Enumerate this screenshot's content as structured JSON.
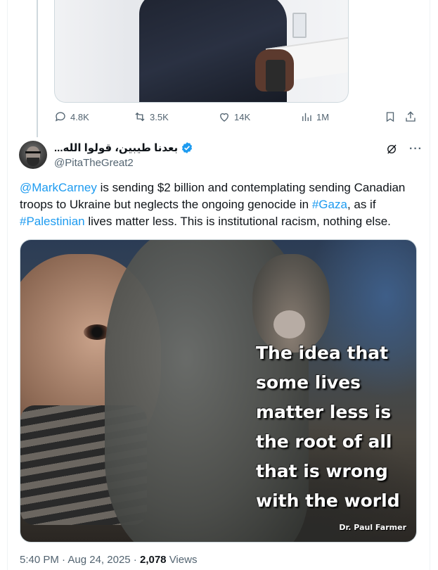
{
  "previous_tweet": {
    "stats": {
      "replies": "4.8K",
      "reposts": "3.5K",
      "likes": "14K",
      "views": "1M"
    }
  },
  "tweet": {
    "display_name": "بعدنا طيبين، قولوا الله...",
    "handle": "@PitaTheGreat2",
    "text": {
      "mention": "@MarkCarney",
      "part1": " is sending $2 billion and contemplating sending Canadian troops to Ukraine but neglects the ongoing genocide in ",
      "hashtag1": "#Gaza",
      "part2": ", as if ",
      "hashtag2": "#Palestinian",
      "part3": " lives matter less. This is institutional racism, nothing else."
    },
    "image": {
      "quote_lines": [
        "The idea that",
        "some lives",
        "matter less is",
        "the root of all",
        "that is wrong",
        "with the world"
      ],
      "author": "Dr. Paul Farmer"
    },
    "time": "5:40 PM",
    "date": "Aug 24, 2025",
    "views_count": "2,078",
    "views_label": "Views"
  },
  "colors": {
    "accent": "#1d9bf0",
    "muted": "#536471",
    "text": "#0f1419",
    "border": "#cfd9de"
  }
}
